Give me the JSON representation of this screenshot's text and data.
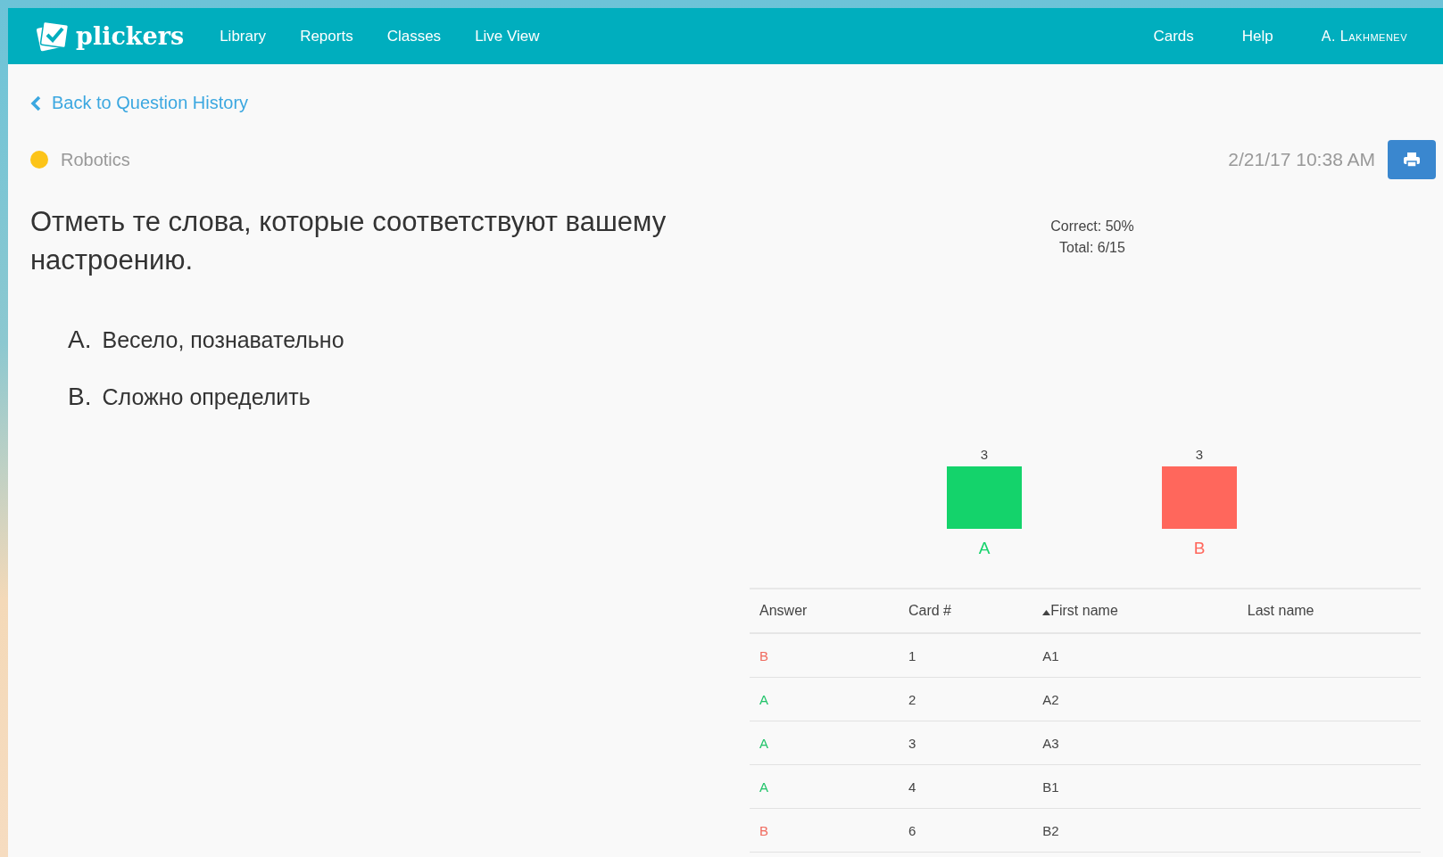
{
  "navbar": {
    "logo": "plickers",
    "left_items": [
      "Library",
      "Reports",
      "Classes",
      "Live View"
    ],
    "right_items": [
      "Cards",
      "Help"
    ],
    "user": "A. Lakhmenev"
  },
  "back_link": "Back to Question History",
  "class": {
    "name": "Robotics",
    "color": "#fcc419"
  },
  "date": "2/21/17 10:38 AM",
  "question": {
    "text": "Отметь те слова, которые соответствуют вашему настроению.",
    "choices": [
      {
        "letter": "A.",
        "text": "Весело, познавательно"
      },
      {
        "letter": "B.",
        "text": "Сложно определить"
      }
    ]
  },
  "stats": {
    "correct": "Correct: 50%",
    "total": "Total: 6/15"
  },
  "chart_data": {
    "type": "bar",
    "categories": [
      "A",
      "B"
    ],
    "values": [
      3,
      3
    ],
    "colors": [
      "#14d36b",
      "#ff675c"
    ],
    "data_labels": true
  },
  "table": {
    "columns": [
      {
        "label": "Answer",
        "sorted": false
      },
      {
        "label": "Card #",
        "sorted": false
      },
      {
        "label": "First name",
        "sorted": true
      },
      {
        "label": "Last name",
        "sorted": false
      }
    ],
    "rows": [
      {
        "answer": "B",
        "correct": false,
        "card": "1",
        "first_name": "A1"
      },
      {
        "answer": "A",
        "correct": true,
        "card": "2",
        "first_name": "A2"
      },
      {
        "answer": "A",
        "correct": true,
        "card": "3",
        "first_name": "A3"
      },
      {
        "answer": "A",
        "correct": true,
        "card": "4",
        "first_name": "B1"
      },
      {
        "answer": "B",
        "correct": false,
        "card": "6",
        "first_name": "B2"
      }
    ]
  }
}
